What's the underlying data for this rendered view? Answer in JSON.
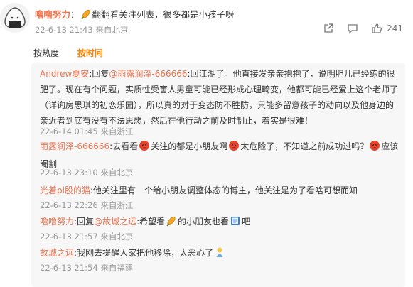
{
  "post": {
    "author": "噜噜努力",
    "sep": "：",
    "text": "翻翻看关注列表，很多都是小孩子呀",
    "time": "22-6-13 21:43",
    "source": "来自北京",
    "like_count": "241",
    "icons": [
      "share-icon",
      "comment-icon",
      "like-icon",
      "flower-emoji"
    ]
  },
  "sort": {
    "by_hot": "按热度",
    "by_time": "按时间",
    "active": "按时间"
  },
  "comments": [
    {
      "user": "Andrew夏安",
      "sep": ":",
      "reply_prefix": "回复",
      "reply_to": "@雨露润泽-666666",
      "reply_sep": ":",
      "text": "回江湖了。他直接发亲亲抱抱了，说明胆儿已经练的很肥了。现在有个问题，实质性受害人男童可能已经形成心理畸变，他都可能已经爱上这个老师了（详询房思琪的初恋乐园），所以真的对于变态防不胜防，只能多留意孩子的动向以及他身边的亲近者到底有没有不法思想，然后在他行动之前及时制止，着实是很难！",
      "time": "22-6-14 01:45",
      "source": "来自浙江"
    },
    {
      "user": "雨露润泽-666666",
      "sep": ":",
      "text_1": "去看看",
      "text_2": "关注的都是小朋友啊",
      "text_3": "太危险了，不知道之前成功过吗？",
      "text_4": "应该阉割",
      "time": "22-6-13 23:10",
      "source": "来自北京"
    },
    {
      "user": "光着pi股的猫",
      "sep": ":",
      "text_1": "他关注里有一个给小朋友调整体态的博主，他关注是为了看啥可想而知",
      "time": "22-6-13 22:26",
      "source": "来自浙江"
    },
    {
      "user": "噜噜努力",
      "sep": ":",
      "reply_prefix": "回复",
      "reply_to": "@故城之远",
      "reply_sep": ":",
      "text_1": "希望看",
      "text_2": "的小朋友也看",
      "text_3": "吧",
      "time": "22-6-13 21:57",
      "source": "来自北京"
    },
    {
      "user": "故城之远",
      "sep": ":",
      "text_1": "我刚去提醒人家把他移除，太恶心了",
      "time": "22-6-13 21:54",
      "source": "来自福建"
    }
  ],
  "emoji_names": [
    "angry-face-emoji",
    "flower-emoji",
    "book-emoji",
    "doll-emoji"
  ],
  "colors": {
    "username": "#eb7350",
    "active_sort": "#ff8200",
    "meta": "#999999",
    "panel_bg": "#f7f7f7"
  }
}
